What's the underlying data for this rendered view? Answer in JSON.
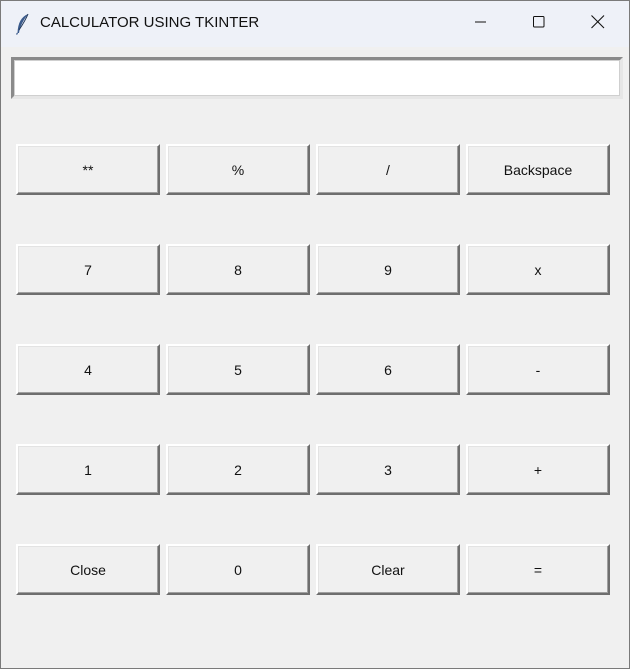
{
  "window": {
    "title": "CALCULATOR USING TKINTER",
    "app_icon": "feather-icon",
    "controls": [
      "minimize-icon",
      "maximize-icon",
      "close-icon"
    ]
  },
  "display": {
    "value": "",
    "placeholder": ""
  },
  "keypad": {
    "rows": [
      [
        "**",
        "%",
        "/",
        "Backspace"
      ],
      [
        "7",
        "8",
        "9",
        "x"
      ],
      [
        "4",
        "5",
        "6",
        "-"
      ],
      [
        "1",
        "2",
        "3",
        "+"
      ],
      [
        "Close",
        "0",
        "Clear",
        "="
      ]
    ]
  },
  "colors": {
    "window_bg": "#f0f0f0",
    "titlebar_bg": "#eef1f8",
    "button_bg": "#f0f0f0",
    "entry_bg": "#ffffff",
    "app_icon": "#3a5a8c"
  }
}
